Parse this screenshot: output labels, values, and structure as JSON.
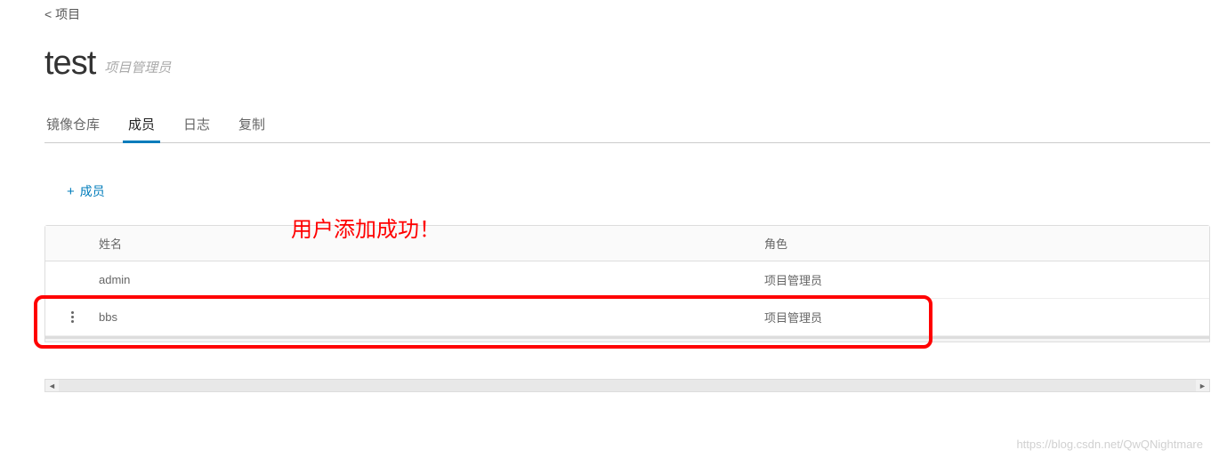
{
  "nav": {
    "back_label": "< 项目"
  },
  "header": {
    "title": "test",
    "role": "项目管理员"
  },
  "tabs": {
    "items": [
      {
        "label": "镜像仓库",
        "active": false
      },
      {
        "label": "成员",
        "active": true
      },
      {
        "label": "日志",
        "active": false
      },
      {
        "label": "复制",
        "active": false
      }
    ]
  },
  "actions": {
    "add_member_label": "成员"
  },
  "annotation": {
    "text": "用户添加成功！"
  },
  "table": {
    "headers": {
      "name": "姓名",
      "role": "角色"
    },
    "rows": [
      {
        "name": "admin",
        "role": "项目管理员",
        "show_menu": false
      },
      {
        "name": "bbs",
        "role": "项目管理员",
        "show_menu": true
      }
    ]
  },
  "watermark": "https://blog.csdn.net/QwQNightmare"
}
